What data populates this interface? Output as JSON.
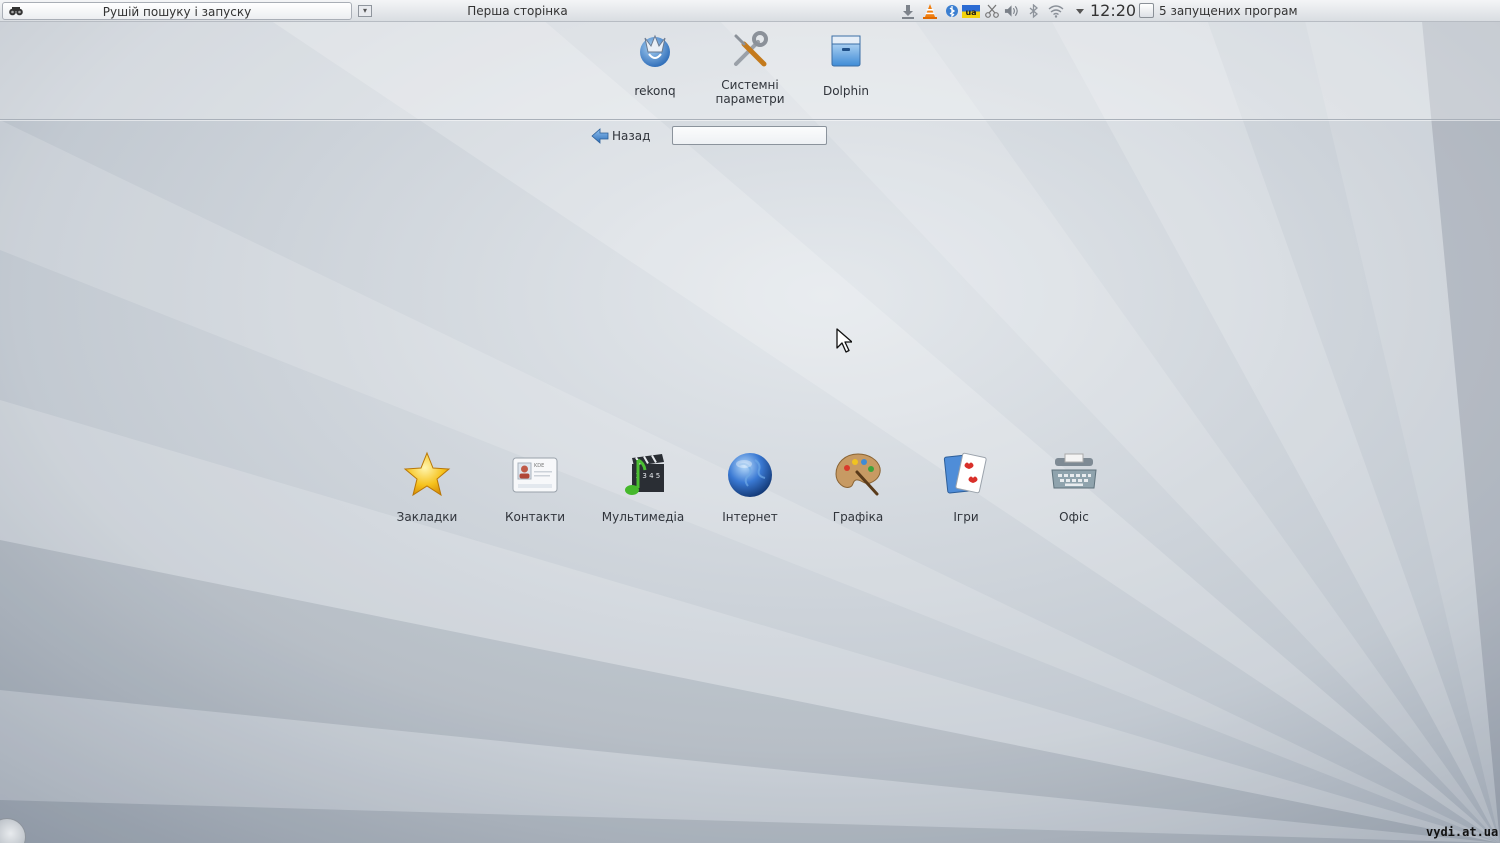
{
  "panel": {
    "search_launcher_label": "Рушій пошуку і запуску",
    "active_window_title": "Перша сторінка",
    "clock": "12:20",
    "tasks_label": "5 запущених програм",
    "tray_icons": [
      "download-icon",
      "vlc-icon",
      "bluetooth-alt-icon",
      "keyboard-layout-icon",
      "clipboard-scissors-icon",
      "volume-icon",
      "bluetooth-icon",
      "wifi-icon",
      "tray-expand-icon"
    ],
    "keyboard_layout": "ua"
  },
  "favorites": [
    {
      "id": "rekonq",
      "label": "rekonq",
      "icon": "rekonq-icon"
    },
    {
      "id": "system-settings",
      "label": "Системні\nпараметри",
      "icon": "tools-icon"
    },
    {
      "id": "dolphin",
      "label": "Dolphin",
      "icon": "dolphin-icon"
    }
  ],
  "navigation": {
    "back_label": "Назад",
    "search_value": "",
    "search_placeholder": ""
  },
  "categories": [
    {
      "id": "bookmarks",
      "label": "Закладки",
      "icon": "star-icon"
    },
    {
      "id": "contacts",
      "label": "Контакти",
      "icon": "contact-card-icon"
    },
    {
      "id": "multimedia",
      "label": "Мультимедіа",
      "icon": "multimedia-icon"
    },
    {
      "id": "internet",
      "label": "Інтернет",
      "icon": "globe-icon"
    },
    {
      "id": "graphics",
      "label": "Графіка",
      "icon": "palette-icon"
    },
    {
      "id": "games",
      "label": "Ігри",
      "icon": "playing-cards-icon"
    },
    {
      "id": "office",
      "label": "Офіс",
      "icon": "typewriter-icon"
    }
  ],
  "contact_card_text": "KDE",
  "multimedia_clapper_text": "2 3 4 5",
  "watermark": "vydi.at.ua",
  "colors": {
    "accent": "#3d6fb5",
    "panel": "#e6e9ed"
  }
}
